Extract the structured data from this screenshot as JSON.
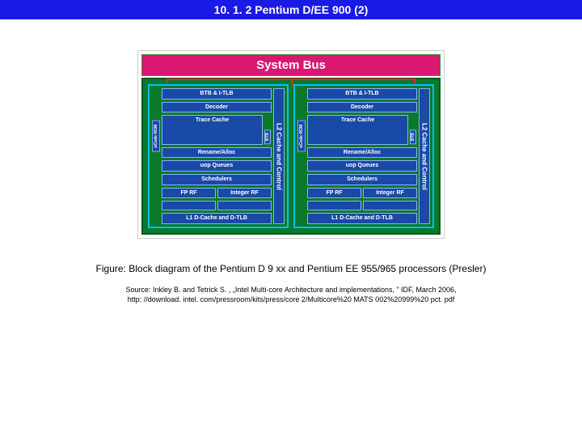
{
  "title": "10. 1. 2 Pentium D/EE 900 (2)",
  "diagram": {
    "system_bus": "System Bus",
    "core": {
      "rom": "uCode ROM",
      "btb_itlb": "BTB & I-TLB",
      "decoder": "Decoder",
      "trace_cache": "Trace Cache",
      "btb_side": "BTB",
      "rename_alloc": "Rename/Alloc",
      "uop_queues": "uop Queues",
      "schedulers": "Schedulers",
      "fp_rf": "FP RF",
      "int_rf": "Integer RF",
      "fp_exec": "",
      "int_exec": "",
      "l1_dcache": "L1 D-Cache and D-TLB",
      "l2": "L2 Cache and Control"
    }
  },
  "caption": "Figure: Block diagram of the Pentium D 9 xx and Pentium EE 955/965 processors (Presler)",
  "source_line1": "Source: Inkley B. and Tetrick S. , „Intel Multi-core Architecture and implementations, ” IDF, March 2006,",
  "source_line2": "http: //download. intel. com/pressroom/kits/press/core 2/Multicore%20 MATS 002%20999%20 pct. pdf"
}
